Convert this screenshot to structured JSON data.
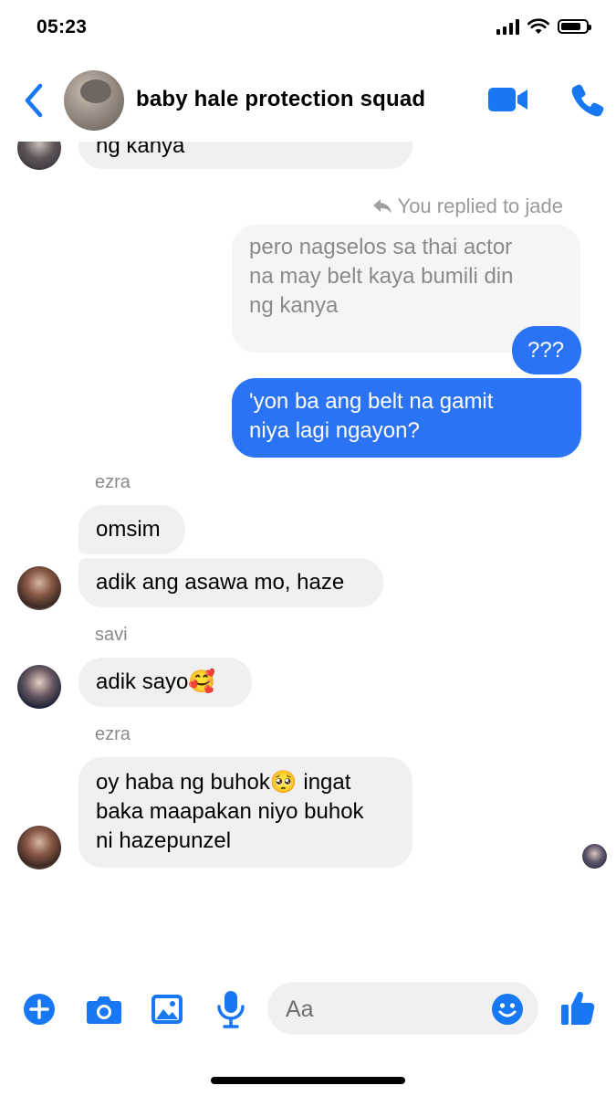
{
  "status_bar": {
    "time": "05:23"
  },
  "header": {
    "title": "baby hale protection squad"
  },
  "messages": {
    "top_partial": "ng kanya",
    "replied_label": "You replied to jade",
    "quoted_lines": [
      "pero nagselos sa thai actor",
      "na may belt kaya bumili din",
      "ng kanya"
    ],
    "out_1": "???",
    "out_2_lines": [
      "'yon ba ang belt na gamit",
      "niya lagi ngayon?"
    ],
    "sender_1": "ezra",
    "in_1": "omsim",
    "in_2": "adik ang asawa mo, haze",
    "sender_2": "savi",
    "in_3": "adik sayo🥰",
    "sender_3": "ezra",
    "in_4_lines": [
      "oy haba ng buhok🥺 ingat",
      "baka maapakan niyo buhok",
      "ni hazepunzel"
    ]
  },
  "composer": {
    "placeholder": "Aa"
  },
  "colors": {
    "accent": "#2b73f5",
    "incoming_bubble": "#f0f0f0",
    "icon_blue": "#1877f2"
  },
  "icons": [
    "back-arrow-icon",
    "video-camera-icon",
    "phone-icon",
    "plus-icon",
    "camera-icon",
    "image-icon",
    "microphone-icon",
    "emoji-icon",
    "thumbs-up-icon",
    "reply-arrow-icon"
  ]
}
